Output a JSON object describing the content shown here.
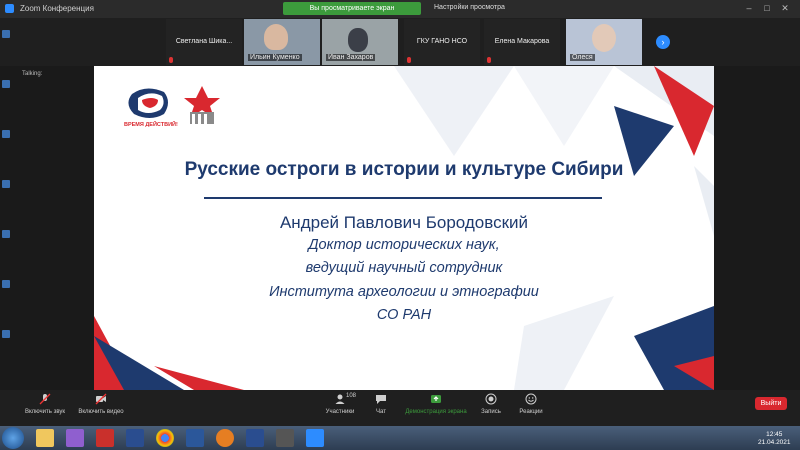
{
  "window": {
    "title": "Zoom Конференция"
  },
  "share_notice": "Вы просматриваете экран Администратора",
  "view_options": "Настройки просмотра",
  "participants": [
    {
      "name": "Светлана  Шика...",
      "video": false
    },
    {
      "name": "Ильин Куменко",
      "video": true
    },
    {
      "name": "Иван Захаров",
      "video": true
    },
    {
      "name": "ГКУ ГАНО НСО",
      "video": false
    },
    {
      "name": "Елена Макарова",
      "video": false
    },
    {
      "name": "Олеся",
      "video": true
    }
  ],
  "share_tag": "Talking:",
  "slide": {
    "logo_text": "ВРЕМЯ ДЕЙСТВИЙ!",
    "title": "Русские остроги в истории и культуре Сибири",
    "author": "Андрей Павлович Бородовский",
    "lines": [
      "Доктор исторических наук,",
      "ведущий научный сотрудник",
      "Института археологии и этнографии",
      "СО РАН"
    ]
  },
  "toolbar": {
    "mute": "Включить звук",
    "video": "Включить видео",
    "participants": "Участники",
    "participants_count": "108",
    "chat": "Чат",
    "share": "Демонстрация экрана",
    "record": "Запись",
    "reactions": "Реакции",
    "leave": "Выйти"
  },
  "clock": {
    "time": "12:45",
    "date": "21.04.2021"
  },
  "colors": {
    "title_blue": "#1e3a6e",
    "accent_red": "#d9282f",
    "share_green": "#3c9b3c"
  }
}
